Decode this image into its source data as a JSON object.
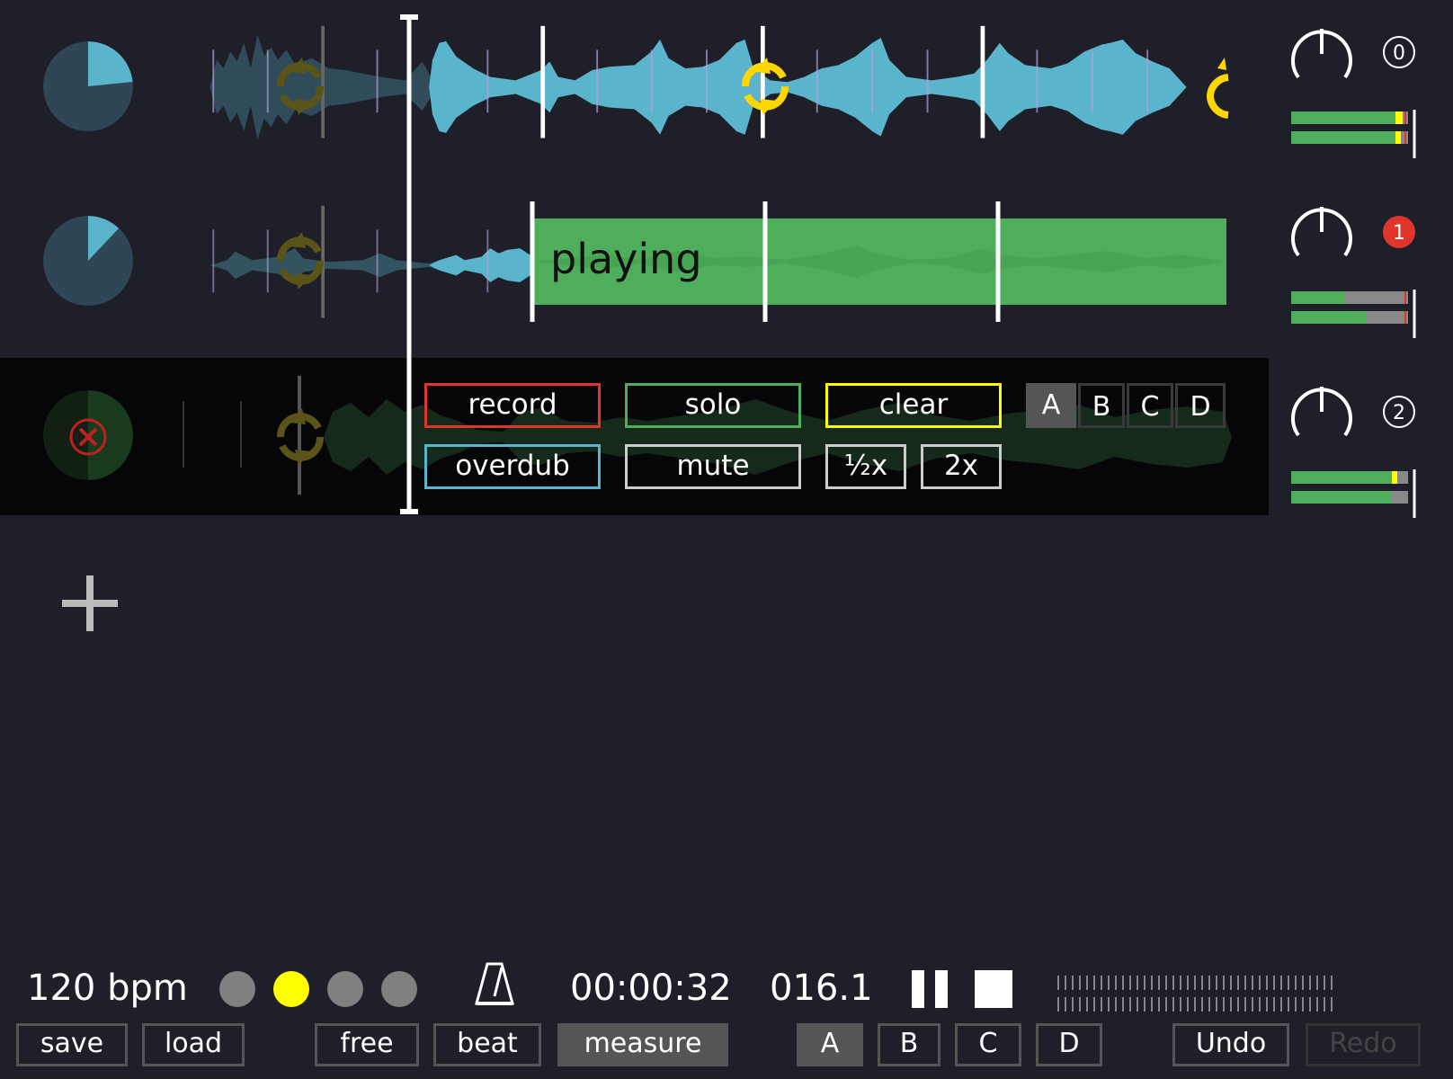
{
  "tracks": [
    {
      "number": "0",
      "state": "normal",
      "progress": 0.22
    },
    {
      "number": "1",
      "state": "playing",
      "progress": 0.1,
      "status_label": "playing"
    },
    {
      "number": "2",
      "state": "focused",
      "progress": 0.55
    }
  ],
  "track_menu": {
    "record": "record",
    "overdub": "overdub",
    "solo": "solo",
    "mute": "mute",
    "clear": "clear",
    "half": "½x",
    "double": "2x",
    "abcd": [
      "A",
      "B",
      "C",
      "D"
    ],
    "abcd_selected": "A"
  },
  "add_track_icon": "plus-icon",
  "transport": {
    "bpm": "120 bpm",
    "beat_dots": [
      false,
      true,
      false,
      false
    ],
    "metronome_icon": "metronome-icon",
    "time": "00:00:32",
    "position": "016.1",
    "pause_icon": "pause-icon",
    "stop_icon": "stop-icon"
  },
  "bottom_bar": {
    "save": "save",
    "load": "load",
    "free": "free",
    "beat": "beat",
    "measure": "measure",
    "scenes": [
      "A",
      "B",
      "C",
      "D"
    ],
    "undo": "Undo",
    "redo": "Redo"
  },
  "colors": {
    "background": "#1f1f29",
    "wave": "#5ab4cc",
    "playing": "#4fae5c",
    "record": "#e0352b",
    "overdub": "#5ab4cc",
    "solo": "#4fae5c",
    "clear": "#ffff00",
    "loop_icon": "#ffd700"
  }
}
